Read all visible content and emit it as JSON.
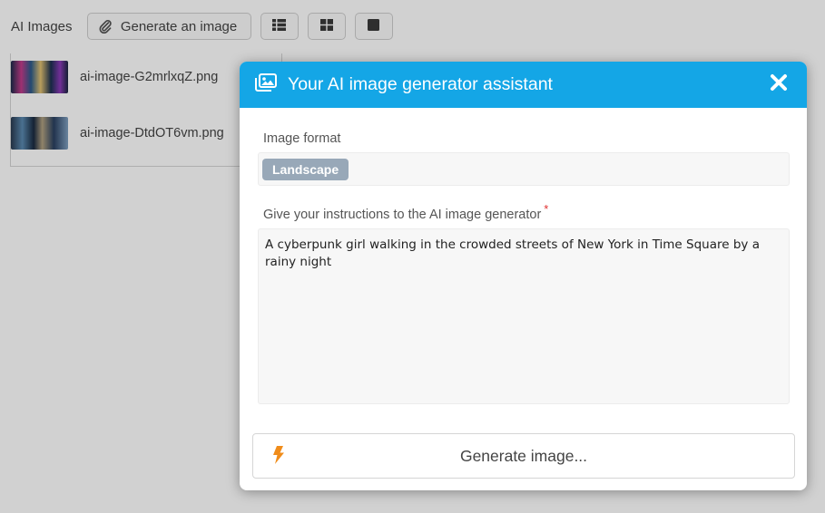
{
  "toolbar": {
    "title": "AI Images",
    "generate_button_label": "Generate an image",
    "icons": [
      "paperclip-icon",
      "list-view-icon",
      "grid-view-icon",
      "single-view-icon"
    ]
  },
  "files": [
    {
      "name": "ai-image-G2mrlxqZ.png"
    },
    {
      "name": "ai-image-DtdOT6vm.png"
    }
  ],
  "modal": {
    "title": "Your AI image generator assistant",
    "header_color": "#14a6e6",
    "format": {
      "label": "Image format",
      "selected": "Landscape"
    },
    "instructions": {
      "label": "Give your instructions to the AI image generator",
      "required_marker": "*",
      "value": "A cyberpunk girl walking in the crowded streets of New York in Time Square by a rainy night"
    },
    "generate_button_label": "Generate image...",
    "accent_color": "#f08c1a"
  }
}
